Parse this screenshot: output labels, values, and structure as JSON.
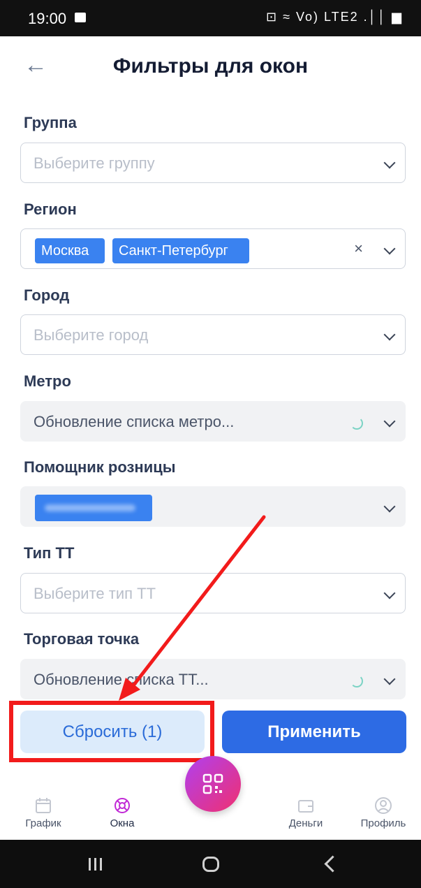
{
  "status_bar": {
    "time": "19:00",
    "indicators": "⊡ ≈ Vo) LTE2 .││ ▆"
  },
  "header": {
    "title": "Фильтры для окон",
    "back_icon": "arrow-left-icon"
  },
  "filters": {
    "group": {
      "label": "Группа",
      "placeholder": "Выберите группу"
    },
    "region": {
      "label": "Регион",
      "tags": [
        "Москва",
        "Санкт-Петербург"
      ],
      "clear": "×"
    },
    "city": {
      "label": "Город",
      "placeholder": "Выберите город"
    },
    "metro": {
      "label": "Метро",
      "value": "Обновление списка метро..."
    },
    "assistant": {
      "label": "Помощник розницы"
    },
    "tt_type": {
      "label": "Тип ТТ",
      "placeholder": "Выберите тип ТТ"
    },
    "outlet": {
      "label": "Торговая точка",
      "value": "Обновление списка ТТ..."
    }
  },
  "actions": {
    "reset_label": "Сбросить (1)",
    "apply_label": "Применить"
  },
  "tabbar": {
    "items": [
      {
        "label": "График",
        "icon": "calendar-icon"
      },
      {
        "label": "Окна",
        "icon": "lifebuoy-icon"
      },
      {
        "label": "Деньги",
        "icon": "wallet-icon"
      },
      {
        "label": "Профиль",
        "icon": "user-icon"
      }
    ]
  },
  "colors": {
    "primary": "#2d6be4",
    "tag": "#3a82f0",
    "annotation": "#f21b1b"
  }
}
